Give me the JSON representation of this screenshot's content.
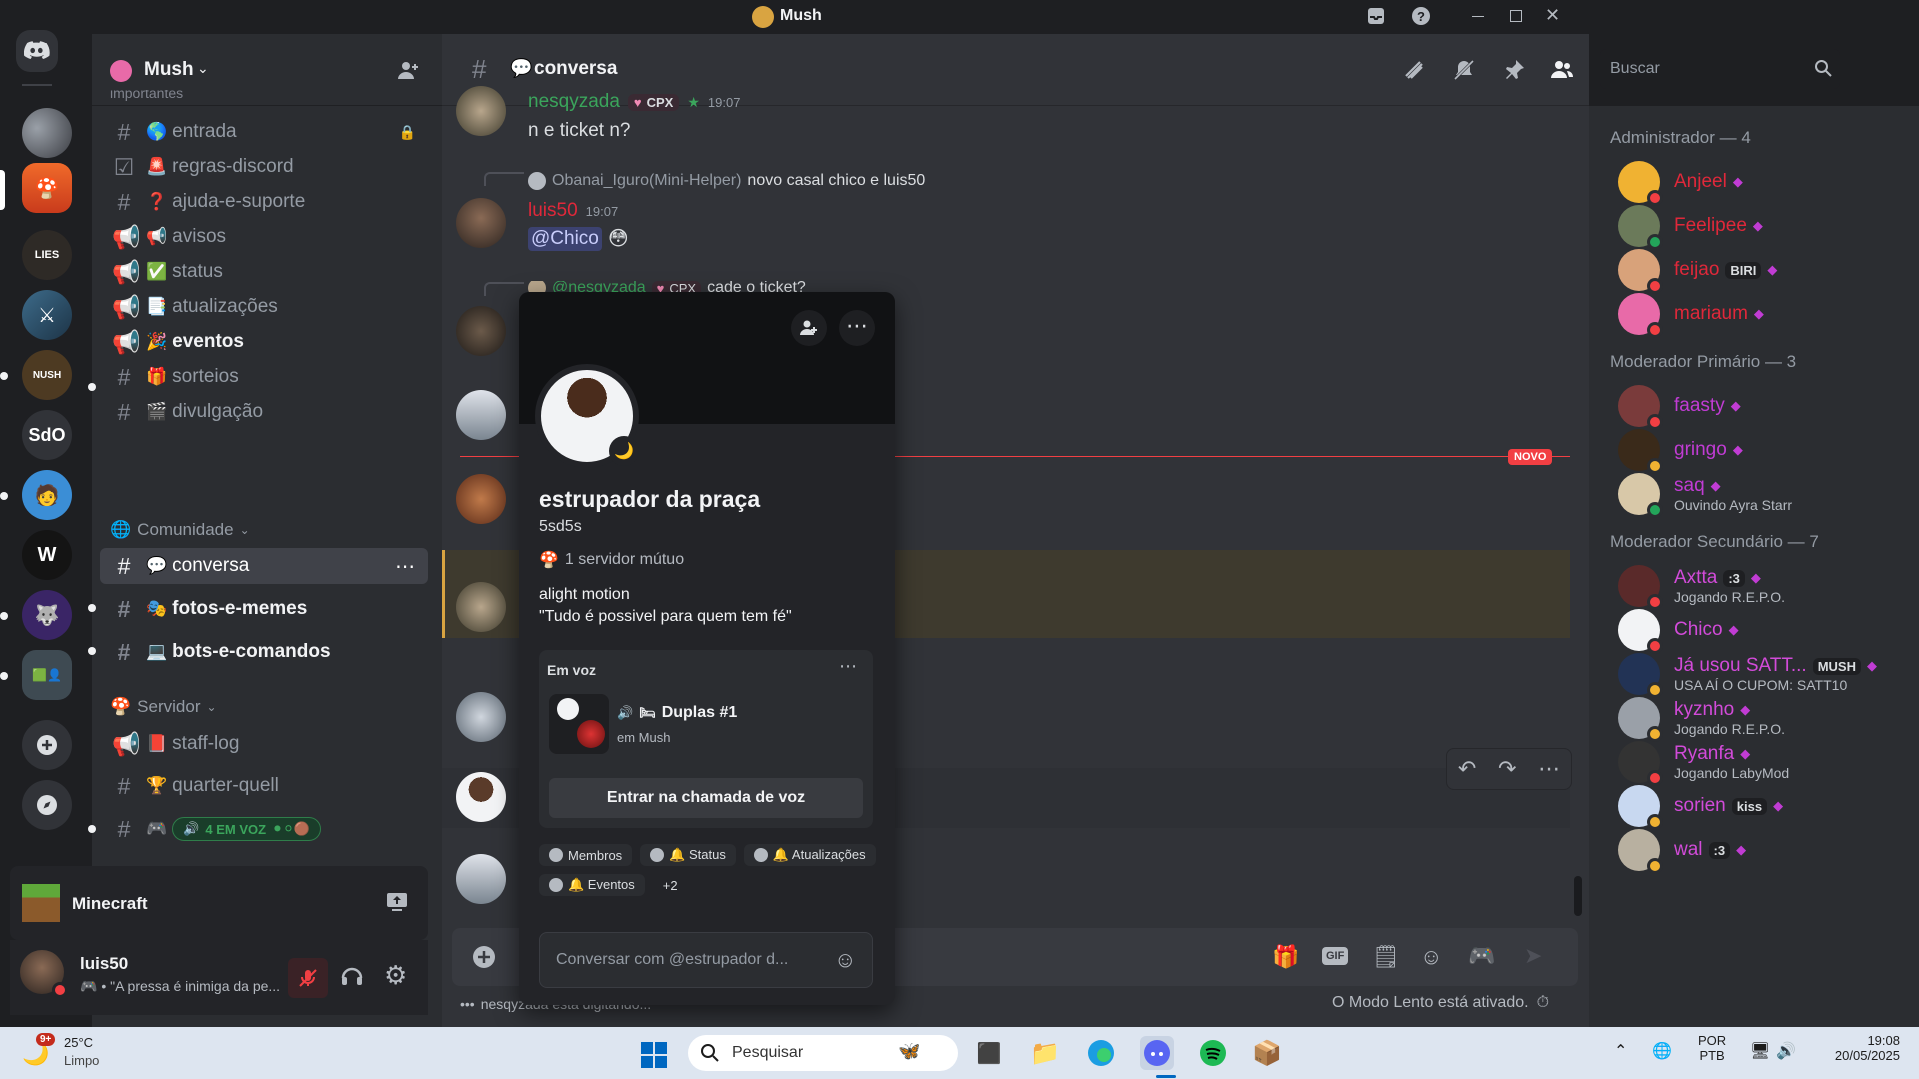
{
  "window": {
    "title": "Mush"
  },
  "server": {
    "name": "Mush"
  },
  "rail": {
    "sdo_label": "SdO"
  },
  "channels": {
    "partial_category": "importantes",
    "items": [
      {
        "label": "entrada",
        "emoji": "🌎"
      },
      {
        "label": "regras-discord",
        "emoji": "🚨"
      },
      {
        "label": "ajuda-e-suporte",
        "emoji": "❓"
      },
      {
        "label": "avisos",
        "emoji": "📢"
      },
      {
        "label": "status",
        "emoji": "✅"
      },
      {
        "label": "atualizações",
        "emoji": "📑"
      },
      {
        "label": "eventos",
        "emoji": "🎉"
      },
      {
        "label": "sorteios",
        "emoji": "🎁"
      },
      {
        "label": "divulgação",
        "emoji": "🎬"
      }
    ],
    "category_comunidade": "Comunidade",
    "comunidade_items": [
      {
        "label": "conversa",
        "emoji": "💬"
      },
      {
        "label": "fotos-e-memes",
        "emoji": "🎭"
      },
      {
        "label": "bots-e-comandos",
        "emoji": "💻"
      }
    ],
    "category_servidor": "Servidor",
    "servidor_items": [
      {
        "label": "staff-log",
        "emoji": "📕"
      },
      {
        "label": "quarter-quell",
        "emoji": "🏆"
      }
    ],
    "voice_badge": "4 EM VOZ"
  },
  "activity": {
    "label": "Minecraft"
  },
  "user": {
    "name": "luis50",
    "status": "• \"A pressa é inimiga da pe..."
  },
  "chat": {
    "channel_name": "conversa",
    "search_placeholder": "Buscar",
    "messages": [
      {
        "author": "nesqyzada",
        "tag": "CPX",
        "time": "19:07",
        "text": "n e ticket n?"
      },
      {
        "reply_author": "Obanai_Iguro(Mini-Helper)",
        "reply_text": "novo casal chico e luis50",
        "author": "luis50",
        "time": "19:07",
        "mention": "@Chico"
      },
      {
        "reply_author": "@nesqyzada",
        "reply_tag": "CPX",
        "reply_text": "cade o ticket?"
      }
    ],
    "new_label": "NOVO",
    "typing": "nesqyzada está digitando...",
    "slowmode": "O Modo Lento está ativado."
  },
  "popout": {
    "display_name": "estrupador da praça",
    "username": "5sd5s",
    "mutual": "1 servidor mútuo",
    "bio_line1": "alight motion",
    "bio_line2": "\"Tudo é possivel para quem tem fé\"",
    "voice_header": "Em voz",
    "voice_channel": "Duplas #1",
    "voice_server": "em Mush",
    "join_button": "Entrar na chamada de voz",
    "roles": [
      "Membros",
      "🔔 Status",
      "🔔 Atualizações",
      "🔔 Eventos"
    ],
    "roles_more": "+2",
    "message_placeholder": "Conversar com @estrupador d..."
  },
  "members": {
    "groups": [
      {
        "title": "Administrador — 4",
        "members": [
          {
            "name": "Anjeel",
            "color": "#e0283a"
          },
          {
            "name": "Feelipee",
            "color": "#e0283a"
          },
          {
            "name": "feijao",
            "color": "#e0283a",
            "badge": "BIRI"
          },
          {
            "name": "mariaum",
            "color": "#e0283a"
          }
        ]
      },
      {
        "title": "Moderador Primário — 3",
        "members": [
          {
            "name": "faasty",
            "color": "#c13cd4"
          },
          {
            "name": "gringo",
            "color": "#c13cd4"
          },
          {
            "name": "saq",
            "color": "#c13cd4",
            "sub": "Ouvindo Ayra Starr"
          }
        ]
      },
      {
        "title": "Moderador Secundário — 7",
        "members": [
          {
            "name": "Axtta",
            "color": "#d24bd9",
            "badge": ":3",
            "sub": "Jogando R.E.P.O."
          },
          {
            "name": "Chico",
            "color": "#d24bd9"
          },
          {
            "name": "Já usou SATT...",
            "color": "#d24bd9",
            "badge": "MUSH",
            "sub": "USA AÍ O CUPOM: SATT10"
          },
          {
            "name": "kyznho",
            "color": "#d24bd9",
            "sub": "Jogando R.E.P.O."
          },
          {
            "name": "Ryanfa",
            "color": "#d24bd9",
            "sub": "Jogando LabyMod"
          },
          {
            "name": "sorien",
            "color": "#d24bd9",
            "badge": "kiss"
          },
          {
            "name": "wal",
            "color": "#d24bd9",
            "badge": ":3"
          }
        ]
      }
    ]
  },
  "taskbar": {
    "weather_temp": "25°C",
    "weather_desc": "Limpo",
    "weather_badge": "9+",
    "search_label": "Pesquisar",
    "lang1": "POR",
    "lang2": "PTB",
    "time": "19:08",
    "date": "20/05/2025"
  }
}
